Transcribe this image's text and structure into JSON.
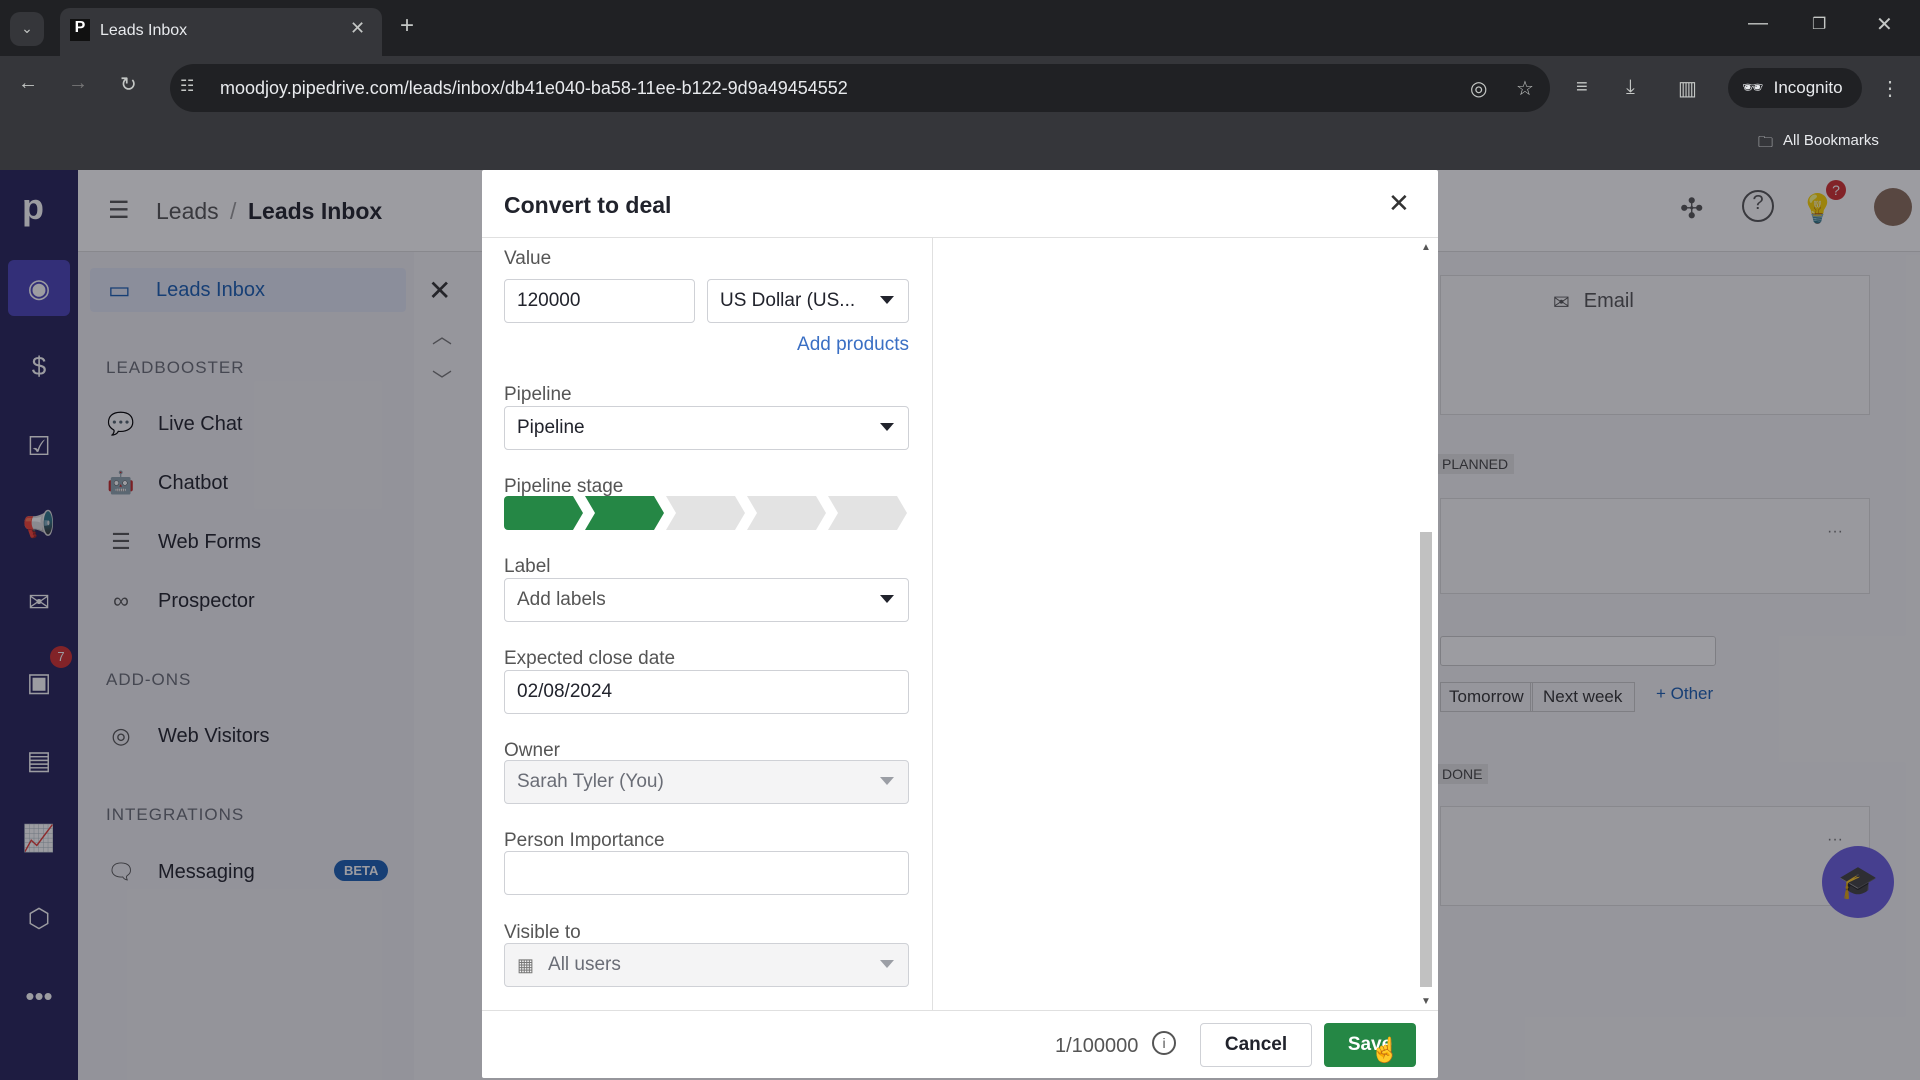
{
  "browser": {
    "tab_title": "Leads Inbox",
    "url": "moodjoy.pipedrive.com/leads/inbox/db41e040-ba58-11ee-b122-9d9a49454552",
    "incognito_label": "Incognito",
    "bookmarks_label": "All Bookmarks"
  },
  "app": {
    "breadcrumb": {
      "parent": "Leads",
      "current": "Leads Inbox"
    },
    "rail_badge": "7",
    "notification_badge": "?",
    "sidebar": {
      "active": "Leads Inbox",
      "sections": [
        {
          "title": "LEADBOOSTER",
          "items": [
            "Live Chat",
            "Chatbot",
            "Web Forms",
            "Prospector"
          ]
        },
        {
          "title": "ADD-ONS",
          "items": [
            "Web Visitors"
          ]
        },
        {
          "title": "INTEGRATIONS",
          "items": [
            "Messaging"
          ]
        }
      ],
      "beta_badge": "BETA"
    },
    "background": {
      "email_tab": "Email",
      "planned": "PLANNED",
      "done": "DONE",
      "tomorrow": "Tomorrow",
      "next_week": "Next week",
      "other": "+ Other"
    }
  },
  "modal": {
    "title": "Convert to deal",
    "value_label": "Value",
    "value": "120000",
    "currency": "US Dollar (US...",
    "add_products": "Add products",
    "pipeline_label": "Pipeline",
    "pipeline": "Pipeline",
    "stage_label": "Pipeline stage",
    "stage_total": 5,
    "stage_current": 2,
    "stage_color": "#258745",
    "label_label": "Label",
    "label_placeholder": "Add labels",
    "close_date_label": "Expected close date",
    "close_date": "02/08/2024",
    "owner_label": "Owner",
    "owner": "Sarah Tyler (You)",
    "importance_label": "Person Importance",
    "importance": "",
    "visible_label": "Visible to",
    "visible": "All users",
    "counter": "1/100000",
    "cancel": "Cancel",
    "save": "Save"
  }
}
